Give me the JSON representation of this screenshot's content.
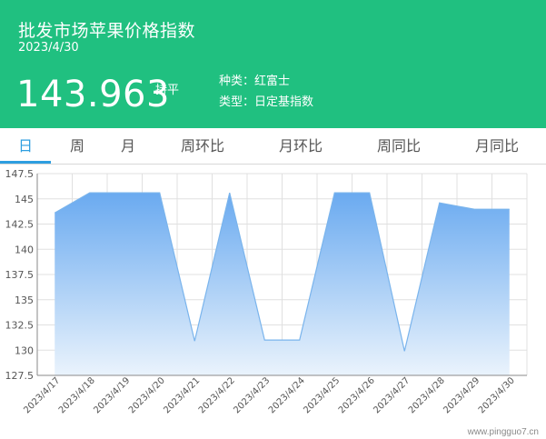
{
  "header": {
    "title": "批发市场苹果价格指数",
    "date": "2023/4/30",
    "value": "143.963",
    "trend": "持平",
    "variety_label": "种类：",
    "variety": "红富士",
    "type_label": "类型：",
    "type": "日定基指数"
  },
  "tabs": [
    {
      "label": "日",
      "active": true
    },
    {
      "label": "周",
      "active": false
    },
    {
      "label": "月",
      "active": false
    },
    {
      "label": "周环比",
      "active": false
    },
    {
      "label": "月环比",
      "active": false
    },
    {
      "label": "周同比",
      "active": false
    },
    {
      "label": "月同比",
      "active": false
    }
  ],
  "colors": {
    "header_bg": "#20c080",
    "accent": "#2d9ee0",
    "area_top": "#6aaaf0",
    "area_bottom": "#eaf3fc",
    "line": "#7ab4ec"
  },
  "chart_data": {
    "type": "area",
    "x": [
      "2023/4/17",
      "2023/4/18",
      "2023/4/19",
      "2023/4/20",
      "2023/4/21",
      "2023/4/22",
      "2023/4/23",
      "2023/4/24",
      "2023/4/25",
      "2023/4/26",
      "2023/4/27",
      "2023/4/28",
      "2023/4/29",
      "2023/4/30"
    ],
    "values": [
      143.6,
      145.6,
      145.6,
      145.6,
      130.9,
      145.6,
      131.0,
      131.0,
      145.6,
      145.6,
      129.9,
      144.6,
      143.963,
      143.963
    ],
    "yticks": [
      "127.5",
      "130",
      "132.5",
      "135",
      "137.5",
      "140",
      "142.5",
      "145",
      "147.5"
    ],
    "ylim": [
      127.5,
      147.5
    ],
    "grid": true
  },
  "watermark": "www.pingguo7.cn"
}
